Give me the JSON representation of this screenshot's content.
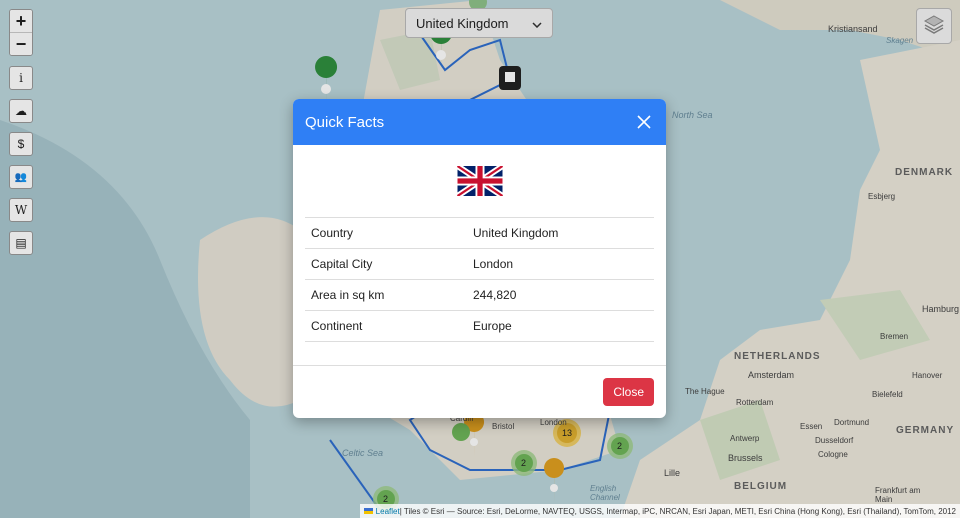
{
  "map": {
    "country_select": {
      "value": "United Kingdom"
    },
    "zoom_in": "+",
    "zoom_out": "−",
    "tool_buttons": [
      {
        "label": "i",
        "icon": "info-icon"
      },
      {
        "label": "☁",
        "icon": "weather-icon"
      },
      {
        "label": "$",
        "icon": "currency-icon"
      },
      {
        "label": "👥",
        "icon": "people-icon"
      },
      {
        "label": "W",
        "icon": "wikipedia-icon"
      },
      {
        "label": "▤",
        "icon": "news-icon"
      }
    ],
    "layers_icon": "layers-icon",
    "labels": {
      "north_sea": "North Sea",
      "denmark": "DENMARK",
      "netherlands": "NETHERLANDS",
      "germany": "GERMANY",
      "belgium": "BELGIUM",
      "celtic_sea": "Celtic Sea",
      "english_channel": "English Channel",
      "kristiansand": "Kristiansand",
      "skagen": "Skagen",
      "esbjerg": "Esbjerg",
      "hamburg": "Hamburg",
      "bremen": "Bremen",
      "hanover": "Hanover",
      "bielefeld": "Bielefeld",
      "amsterdam": "Amsterdam",
      "the_hague": "The Hague",
      "rotterdam": "Rotterdam",
      "antwerp": "Antwerp",
      "brussels": "Brussels",
      "lille": "Lille",
      "essen": "Essen",
      "dortmund": "Dortmund",
      "dusseldorf": "Dusseldorf",
      "cologne": "Cologne",
      "frankfurt": "Frankfurt am Main",
      "bristol": "Bristol",
      "cardiff": "Cardiff",
      "london": "London"
    },
    "clusters": [
      "13",
      "2",
      "2",
      "2"
    ],
    "attribution": {
      "leaflet": "Leaflet",
      "text": " | Tiles © Esri — Source: Esri, DeLorme, NAVTEQ, USGS, Intermap, iPC, NRCAN, Esri Japan, METI, Esri China (Hong Kong), Esri (Thailand), TomTom, 2012"
    }
  },
  "modal": {
    "title": "Quick Facts",
    "flag_icon": "uk-flag",
    "rows": [
      {
        "key": "Country",
        "value": "United Kingdom"
      },
      {
        "key": "Capital City",
        "value": "London"
      },
      {
        "key": "Area in sq km",
        "value": "244,820"
      },
      {
        "key": "Continent",
        "value": "Europe"
      }
    ],
    "close_label": "Close"
  },
  "colors": {
    "header_blue": "#2f7ff5",
    "close_red": "#dc3545",
    "marker_green": "#2f8f3f",
    "marker_orange": "#e0a020",
    "border_line": "#2f6fd0"
  }
}
